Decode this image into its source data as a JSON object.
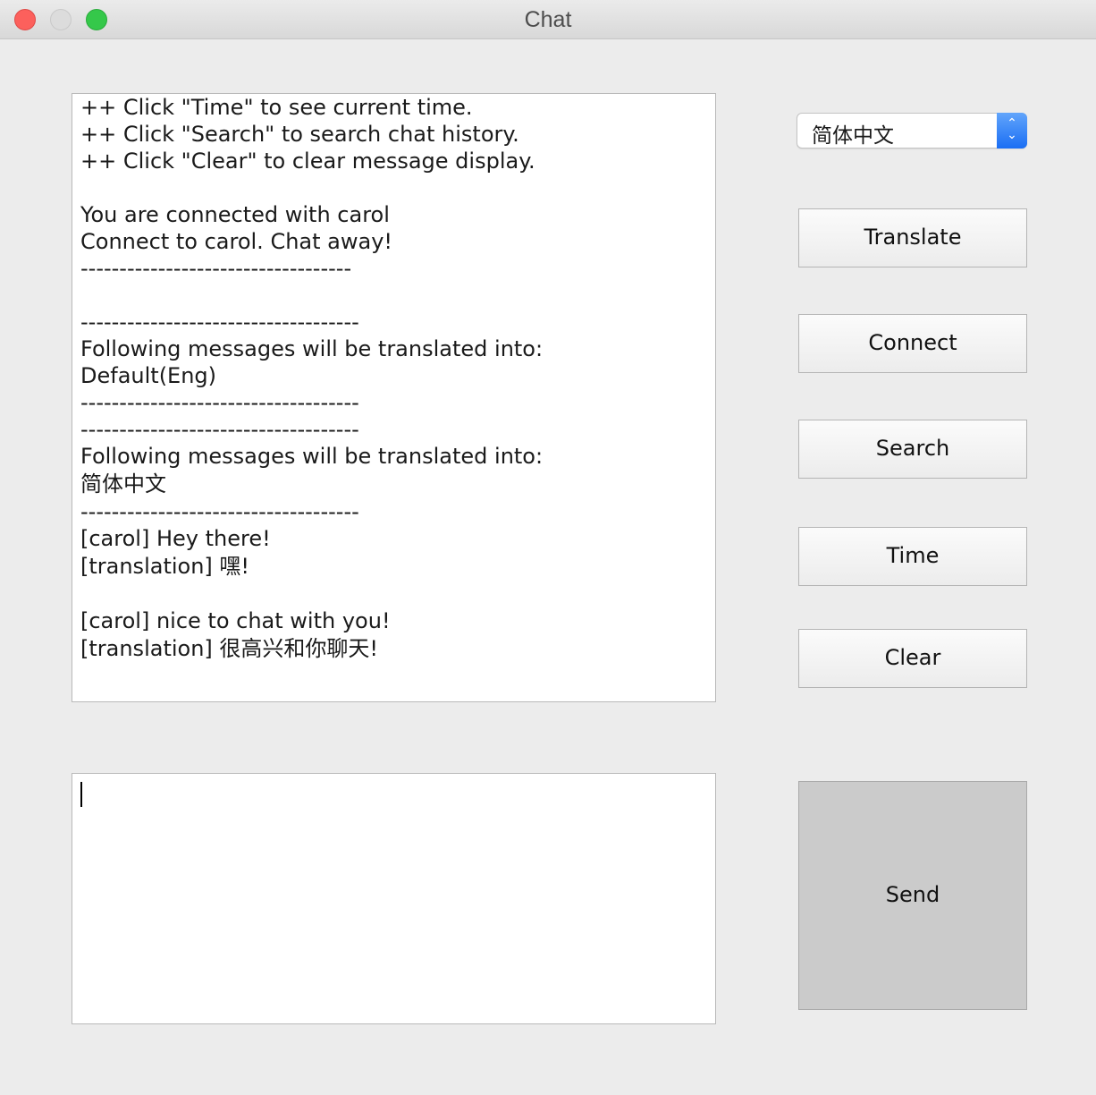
{
  "window": {
    "title": "Chat"
  },
  "chat": {
    "lines": [
      "++ Click \"Time\" to see current time.",
      "++ Click \"Search\" to search chat history.",
      "++ Click \"Clear\" to clear message display.",
      "",
      "You are connected with carol",
      "Connect to carol. Chat away!",
      "-----------------------------------",
      "",
      "------------------------------------",
      "Following messages will be translated into:",
      "Default(Eng)",
      "------------------------------------",
      "------------------------------------",
      "Following messages will be translated into:",
      "简体中文",
      "------------------------------------",
      "[carol] Hey there!",
      "[translation] 嘿!",
      "",
      "[carol] nice to chat with you!",
      "[translation] 很高兴和你聊天!"
    ]
  },
  "input": {
    "value": ""
  },
  "language_select": {
    "selected": "简体中文"
  },
  "buttons": {
    "translate": "Translate",
    "connect": "Connect",
    "search": "Search",
    "time": "Time",
    "clear": "Clear",
    "send": "Send"
  },
  "colors": {
    "accent": "#1a6ef4",
    "window_bg": "#ececec"
  }
}
